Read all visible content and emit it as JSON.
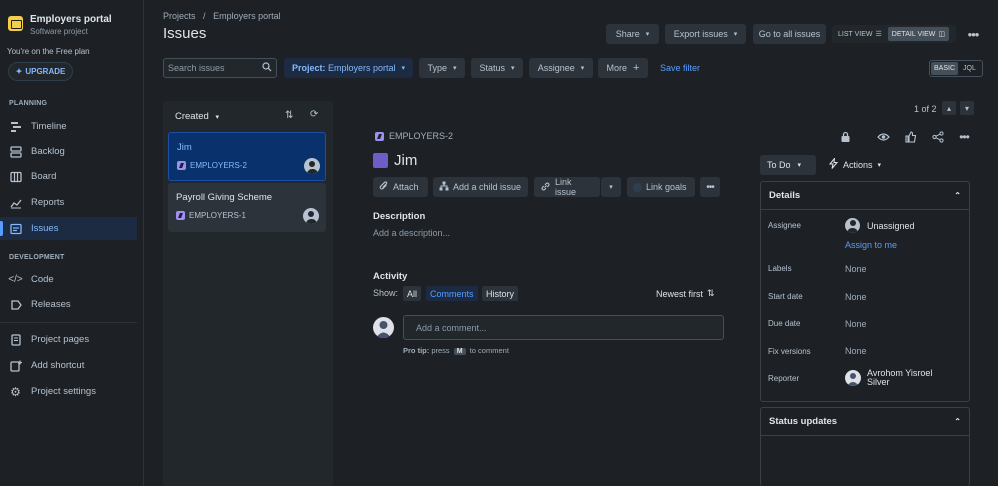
{
  "sidebar": {
    "project_name": "Employers portal",
    "project_type": "Software project",
    "plan_text": "You're on the Free plan",
    "upgrade_label": "UPGRADE",
    "planning_label": "PLANNING",
    "development_label": "DEVELOPMENT",
    "planning_items": [
      {
        "label": "Timeline",
        "icon": "timeline-icon"
      },
      {
        "label": "Backlog",
        "icon": "backlog-icon"
      },
      {
        "label": "Board",
        "icon": "board-icon"
      },
      {
        "label": "Reports",
        "icon": "reports-icon"
      },
      {
        "label": "Issues",
        "icon": "issues-icon",
        "active": true
      }
    ],
    "dev_items": [
      {
        "label": "Code",
        "icon": "code-icon"
      },
      {
        "label": "Releases",
        "icon": "releases-icon"
      }
    ],
    "bottom_items": [
      {
        "label": "Project pages",
        "icon": "pages-icon"
      },
      {
        "label": "Add shortcut",
        "icon": "add-shortcut-icon"
      },
      {
        "label": "Project settings",
        "icon": "settings-icon"
      }
    ]
  },
  "header": {
    "breadcrumb_projects": "Projects",
    "breadcrumb_sep": "/",
    "breadcrumb_current": "Employers portal",
    "title": "Issues",
    "share_label": "Share",
    "export_label": "Export issues",
    "goto_all_label": "Go to all issues",
    "list_view_label": "LIST VIEW",
    "detail_view_label": "DETAIL VIEW"
  },
  "filters": {
    "search_placeholder": "Search issues",
    "project_prefix": "Project:",
    "project_value": "Employers portal",
    "type_label": "Type",
    "status_label": "Status",
    "assignee_label": "Assignee",
    "more_label": "More",
    "save_filter_label": "Save filter",
    "basic_label": "BASIC",
    "jql_label": "JQL"
  },
  "list": {
    "sort_label": "Created",
    "issues": [
      {
        "title": "Jim",
        "key": "EMPLOYERS-2",
        "selected": true
      },
      {
        "title": "Payroll Giving Scheme",
        "key": "EMPLOYERS-1",
        "selected": false
      }
    ]
  },
  "pager": {
    "text": "1 of 2"
  },
  "detail": {
    "key": "EMPLOYERS-2",
    "title": "Jim",
    "attach_label": "Attach",
    "add_child_label": "Add a child issue",
    "link_issue_label": "Link issue",
    "link_goals_label": "Link goals",
    "description_heading": "Description",
    "description_placeholder": "Add a description...",
    "activity_heading": "Activity",
    "show_label": "Show:",
    "filter_all": "All",
    "filter_comments": "Comments",
    "filter_history": "History",
    "sort_label": "Newest first",
    "comment_placeholder": "Add a comment...",
    "protip_prefix": "Pro tip:",
    "protip_press": "press",
    "protip_key": "M",
    "protip_suffix": "to comment"
  },
  "side": {
    "status_label": "To Do",
    "actions_label": "Actions",
    "details_heading": "Details",
    "assignee_label": "Assignee",
    "assignee_value": "Unassigned",
    "assign_to_me": "Assign to me",
    "labels_label": "Labels",
    "labels_value": "None",
    "start_date_label": "Start date",
    "start_date_value": "None",
    "due_date_label": "Due date",
    "due_date_value": "None",
    "fix_versions_label": "Fix versions",
    "fix_versions_value": "None",
    "reporter_label": "Reporter",
    "reporter_value_line1": "Avrohom Yisroel",
    "reporter_value_line2": "Silver",
    "status_updates_heading": "Status updates"
  }
}
